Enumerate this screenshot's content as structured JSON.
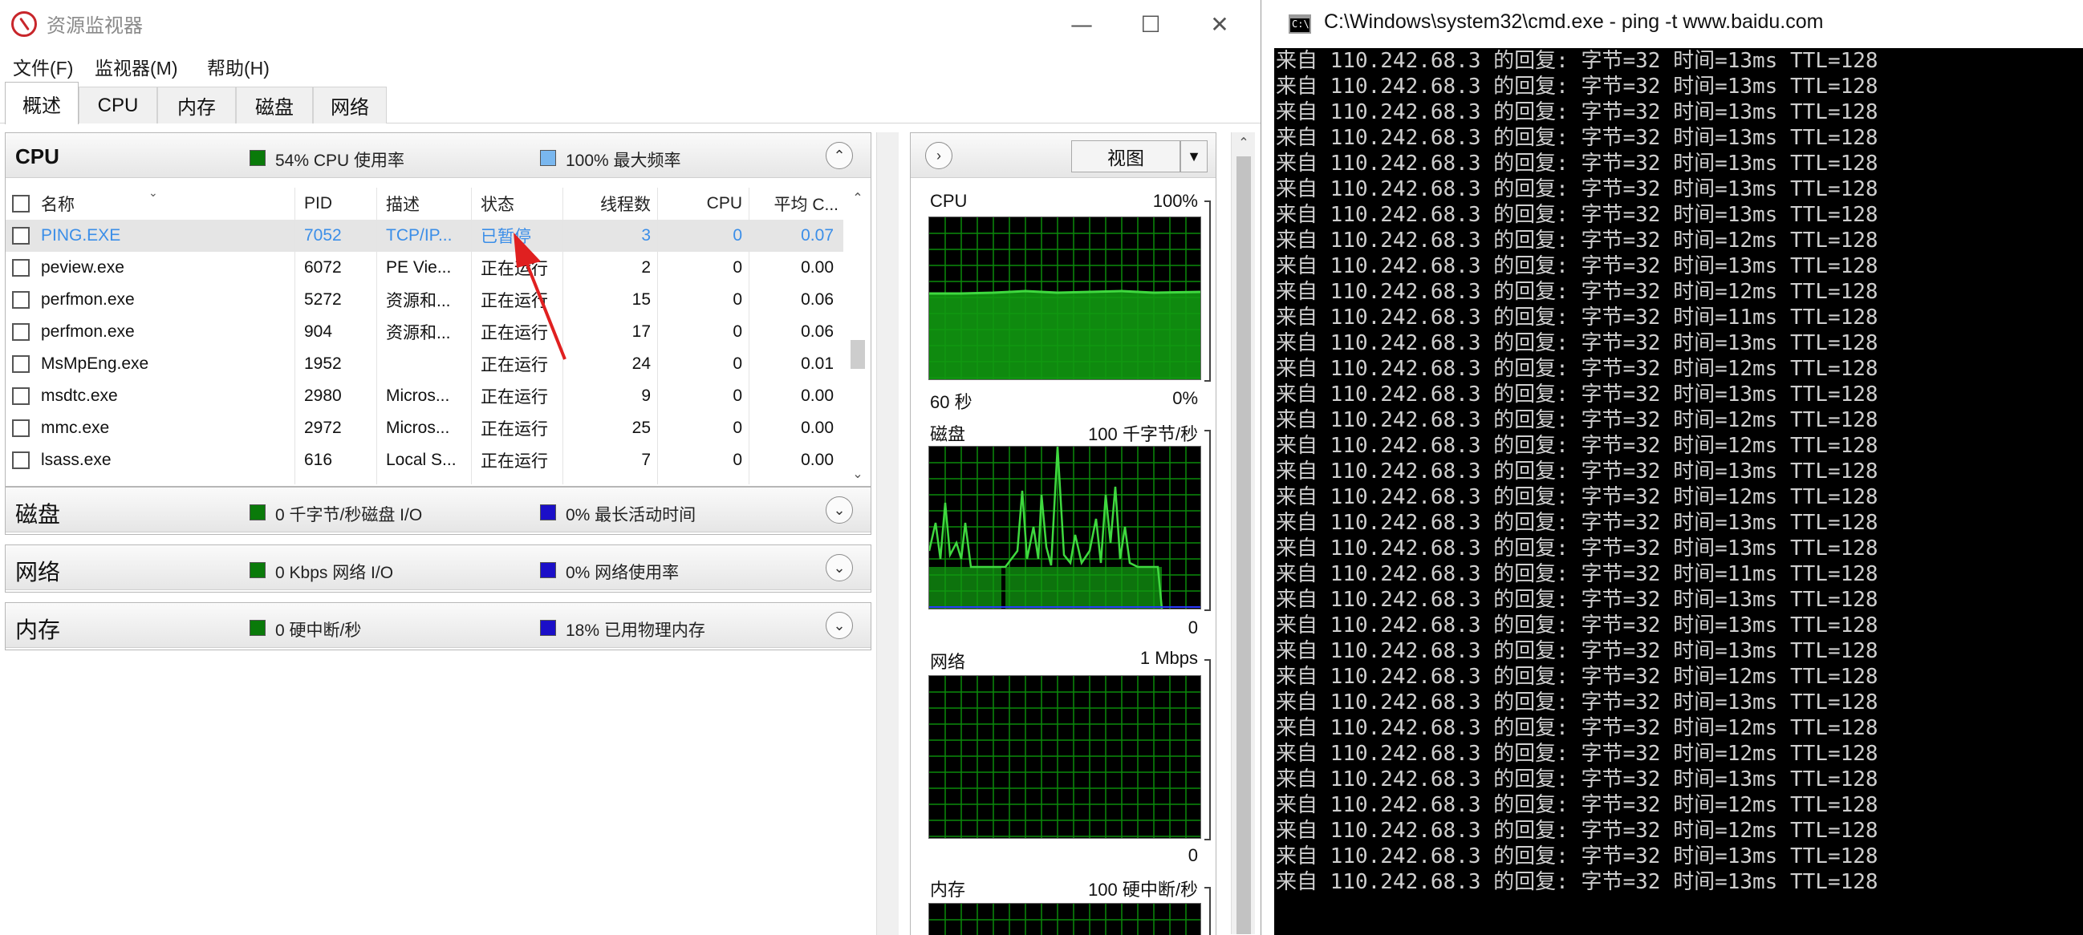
{
  "resmon": {
    "title": "资源监视器",
    "menu": [
      "文件(F)",
      "监视器(M)",
      "帮助(H)"
    ],
    "tabs": [
      "概述",
      "CPU",
      "内存",
      "磁盘",
      "网络"
    ],
    "cpu": {
      "name": "CPU",
      "stat1": "54% CPU 使用率",
      "stat2": "100% 最大频率",
      "headers": [
        "名称",
        "PID",
        "描述",
        "状态",
        "线程数",
        "CPU",
        "平均 C..."
      ],
      "rows": [
        {
          "name": "PING.EXE",
          "pid": "7052",
          "desc": "TCP/IP...",
          "status": "已暂停",
          "threads": "3",
          "cpu": "0",
          "avg": "0.07"
        },
        {
          "name": "peview.exe",
          "pid": "6072",
          "desc": "PE Vie...",
          "status": "正在运行",
          "threads": "2",
          "cpu": "0",
          "avg": "0.00"
        },
        {
          "name": "perfmon.exe",
          "pid": "5272",
          "desc": "资源和...",
          "status": "正在运行",
          "threads": "15",
          "cpu": "0",
          "avg": "0.06"
        },
        {
          "name": "perfmon.exe",
          "pid": "904",
          "desc": "资源和...",
          "status": "正在运行",
          "threads": "17",
          "cpu": "0",
          "avg": "0.06"
        },
        {
          "name": "MsMpEng.exe",
          "pid": "1952",
          "desc": "",
          "status": "正在运行",
          "threads": "24",
          "cpu": "0",
          "avg": "0.01"
        },
        {
          "name": "msdtc.exe",
          "pid": "2980",
          "desc": "Micros...",
          "status": "正在运行",
          "threads": "9",
          "cpu": "0",
          "avg": "0.00"
        },
        {
          "name": "mmc.exe",
          "pid": "2972",
          "desc": "Micros...",
          "status": "正在运行",
          "threads": "25",
          "cpu": "0",
          "avg": "0.00"
        },
        {
          "name": "lsass.exe",
          "pid": "616",
          "desc": "Local S...",
          "status": "正在运行",
          "threads": "7",
          "cpu": "0",
          "avg": "0.00"
        }
      ]
    },
    "disk": {
      "name": "磁盘",
      "stat1": "0 千字节/秒磁盘 I/O",
      "stat2": "0% 最长活动时间"
    },
    "network": {
      "name": "网络",
      "stat1": "0 Kbps 网络 I/O",
      "stat2": "0% 网络使用率"
    },
    "memory": {
      "name": "内存",
      "stat1": "0 硬中断/秒",
      "stat2": "18% 已用物理内存"
    },
    "graphs": {
      "view_label": "视图",
      "cpu": {
        "label": "CPU",
        "max": "100%",
        "time": "60 秒",
        "min": "0%"
      },
      "disk": {
        "label": "磁盘",
        "max": "100 千字节/秒",
        "min": "0"
      },
      "network": {
        "label": "网络",
        "max": "1 Mbps",
        "min": "0"
      },
      "memory": {
        "label": "内存",
        "max": "100 硬中断/秒"
      }
    },
    "colors": {
      "green_swatch": "#0a7a0a",
      "cpu_max_swatch": "#79b7ef",
      "blue_swatch": "#1b0fc8",
      "highlight_text": "#3b8ee8"
    }
  },
  "cmd": {
    "title": "C:\\Windows\\system32\\cmd.exe - ping  -t www.baidu.com",
    "lines": [
      "来自 110.242.68.3 的回复: 字节=32 时间=13ms TTL=128",
      "来自 110.242.68.3 的回复: 字节=32 时间=13ms TTL=128",
      "来自 110.242.68.3 的回复: 字节=32 时间=13ms TTL=128",
      "来自 110.242.68.3 的回复: 字节=32 时间=13ms TTL=128",
      "来自 110.242.68.3 的回复: 字节=32 时间=13ms TTL=128",
      "来自 110.242.68.3 的回复: 字节=32 时间=13ms TTL=128",
      "来自 110.242.68.3 的回复: 字节=32 时间=13ms TTL=128",
      "来自 110.242.68.3 的回复: 字节=32 时间=12ms TTL=128",
      "来自 110.242.68.3 的回复: 字节=32 时间=13ms TTL=128",
      "来自 110.242.68.3 的回复: 字节=32 时间=12ms TTL=128",
      "来自 110.242.68.3 的回复: 字节=32 时间=11ms TTL=128",
      "来自 110.242.68.3 的回复: 字节=32 时间=13ms TTL=128",
      "来自 110.242.68.3 的回复: 字节=32 时间=12ms TTL=128",
      "来自 110.242.68.3 的回复: 字节=32 时间=13ms TTL=128",
      "来自 110.242.68.3 的回复: 字节=32 时间=12ms TTL=128",
      "来自 110.242.68.3 的回复: 字节=32 时间=12ms TTL=128",
      "来自 110.242.68.3 的回复: 字节=32 时间=13ms TTL=128",
      "来自 110.242.68.3 的回复: 字节=32 时间=12ms TTL=128",
      "来自 110.242.68.3 的回复: 字节=32 时间=13ms TTL=128",
      "来自 110.242.68.3 的回复: 字节=32 时间=13ms TTL=128",
      "来自 110.242.68.3 的回复: 字节=32 时间=11ms TTL=128",
      "来自 110.242.68.3 的回复: 字节=32 时间=13ms TTL=128",
      "来自 110.242.68.3 的回复: 字节=32 时间=13ms TTL=128",
      "来自 110.242.68.3 的回复: 字节=32 时间=13ms TTL=128",
      "来自 110.242.68.3 的回复: 字节=32 时间=12ms TTL=128",
      "来自 110.242.68.3 的回复: 字节=32 时间=13ms TTL=128",
      "来自 110.242.68.3 的回复: 字节=32 时间=12ms TTL=128",
      "来自 110.242.68.3 的回复: 字节=32 时间=12ms TTL=128",
      "来自 110.242.68.3 的回复: 字节=32 时间=13ms TTL=128",
      "来自 110.242.68.3 的回复: 字节=32 时间=12ms TTL=128",
      "来自 110.242.68.3 的回复: 字节=32 时间=12ms TTL=128",
      "来自 110.242.68.3 的回复: 字节=32 时间=13ms TTL=128",
      "来自 110.242.68.3 的回复: 字节=32 时间=13ms TTL=128"
    ]
  }
}
